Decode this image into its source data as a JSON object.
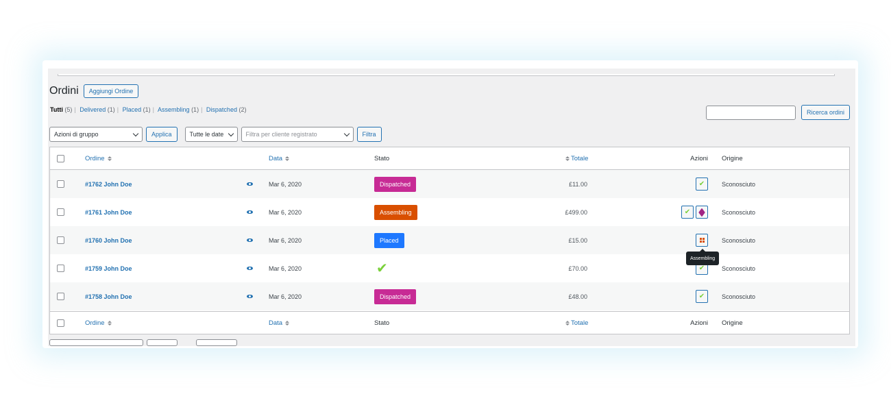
{
  "header": {
    "title": "Ordini",
    "add_button": "Aggiungi Ordine"
  },
  "views": [
    {
      "label": "Tutti",
      "count": "(5)",
      "current": true
    },
    {
      "label": "Delivered",
      "count": "(1)"
    },
    {
      "label": "Placed",
      "count": "(1)"
    },
    {
      "label": "Assembling",
      "count": "(1)"
    },
    {
      "label": "Dispatched",
      "count": "(2)"
    }
  ],
  "search": {
    "value": "",
    "button": "Ricerca ordini"
  },
  "filters": {
    "bulk_actions": "Azioni di gruppo",
    "apply": "Applica",
    "dates": "Tutte le date",
    "customer_placeholder": "Filtra per cliente registrato",
    "filter_button": "Filtra"
  },
  "columns": {
    "order": "Ordine",
    "date": "Data",
    "status": "Stato",
    "total": "Totale",
    "actions": "Azioni",
    "origin": "Origine"
  },
  "orders": [
    {
      "number": "#1762 John Doe",
      "date": "Mar 6, 2020",
      "status": "Dispatched",
      "status_type": "dispatched",
      "total": "£11.00",
      "actions": [
        "complete"
      ],
      "origin": "Sconosciuto"
    },
    {
      "number": "#1761 John Doe",
      "date": "Mar 6, 2020",
      "status": "Assembling",
      "status_type": "assembling",
      "total": "£499.00",
      "actions": [
        "complete",
        "dispatch"
      ],
      "origin": "Sconosciuto"
    },
    {
      "number": "#1760 John Doe",
      "date": "Mar 6, 2020",
      "status": "Placed",
      "status_type": "placed",
      "total": "£15.00",
      "actions": [
        "assemble"
      ],
      "origin": "Sconosciuto"
    },
    {
      "number": "#1759 John Doe",
      "date": "Mar 6, 2020",
      "status": "",
      "status_type": "completed",
      "total": "£70.00",
      "actions": [
        "complete"
      ],
      "origin": "Sconosciuto"
    },
    {
      "number": "#1758 John Doe",
      "date": "Mar 6, 2020",
      "status": "Dispatched",
      "status_type": "dispatched",
      "total": "£48.00",
      "actions": [
        "complete"
      ],
      "origin": "Sconosciuto"
    }
  ],
  "tooltip": "Assembling",
  "colors": {
    "accent": "#2271b1",
    "dispatched": "#c72b95",
    "assembling": "#d94f00",
    "placed": "#1e78ff",
    "completed": "#7ad03a"
  }
}
